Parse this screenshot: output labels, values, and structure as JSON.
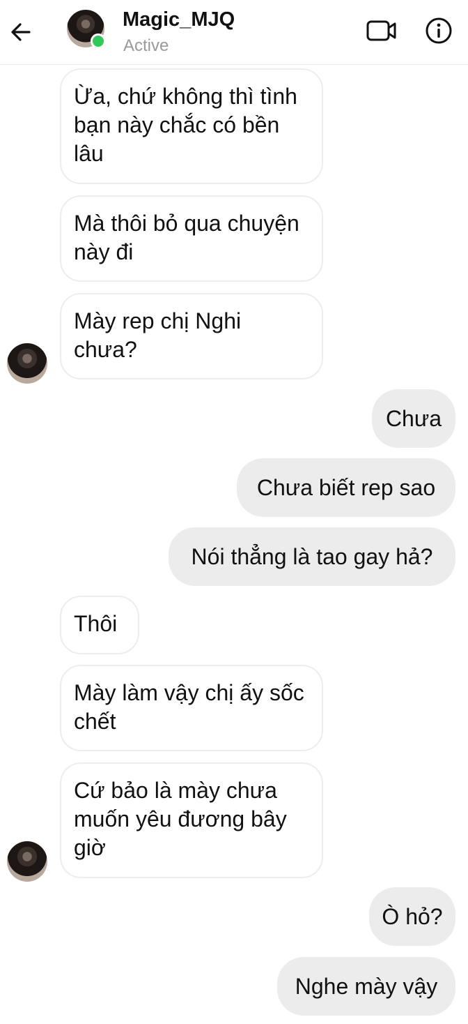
{
  "header": {
    "contact_name": "Magic_MJQ",
    "status": "Active",
    "icons": [
      "back-arrow-icon",
      "video-call-icon",
      "info-icon"
    ],
    "online_color": "#31c75a"
  },
  "messages": [
    {
      "from": "them",
      "text": "Ừa, chứ không thì tình bạn này chắc có bền lâu"
    },
    {
      "from": "them",
      "text": "Mà thôi bỏ qua chuyện này đi"
    },
    {
      "from": "them",
      "text": "Mày rep chị Nghi chưa?"
    },
    {
      "from": "me",
      "text": "Chưa"
    },
    {
      "from": "me",
      "text": "Chưa biết rep sao"
    },
    {
      "from": "me",
      "text": "Nói thẳng là tao gay hả?"
    },
    {
      "from": "them",
      "text": "Thôi"
    },
    {
      "from": "them",
      "text": "Mày làm vậy chị ấy sốc chết"
    },
    {
      "from": "them",
      "text": "Cứ bảo là mày chưa muốn yêu đương bây giờ"
    },
    {
      "from": "me",
      "text": "Ò hỏ?"
    },
    {
      "from": "me",
      "text": "Nghe mày vậy"
    }
  ],
  "colors": {
    "incoming_bg": "#ffffff",
    "outgoing_bg": "#ececec"
  }
}
